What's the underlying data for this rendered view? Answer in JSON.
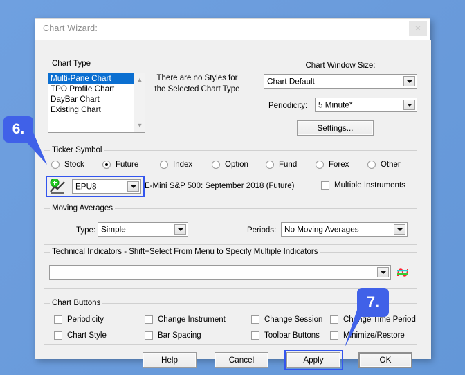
{
  "window": {
    "title": "Chart Wizard:",
    "close_label": "✕"
  },
  "chart_type": {
    "group_label": "Chart Type",
    "items": [
      {
        "label": "Multi-Pane Chart",
        "selected": true
      },
      {
        "label": "TPO Profile Chart",
        "selected": false
      },
      {
        "label": "DayBar Chart",
        "selected": false
      },
      {
        "label": "Existing Chart",
        "selected": false
      }
    ],
    "styles_note_line1": "There are no Styles for",
    "styles_note_line2": "the Selected Chart Type"
  },
  "chart_window": {
    "size_label": "Chart Window Size:",
    "size_value": "Chart Default",
    "periodicity_label": "Periodicity:",
    "periodicity_value": "5 Minute*",
    "settings_button": "Settings..."
  },
  "ticker": {
    "group_label": "Ticker Symbol",
    "radios": [
      {
        "label": "Stock",
        "selected": false
      },
      {
        "label": "Future",
        "selected": true
      },
      {
        "label": "Index",
        "selected": false
      },
      {
        "label": "Option",
        "selected": false
      },
      {
        "label": "Fund",
        "selected": false
      },
      {
        "label": "Forex",
        "selected": false
      },
      {
        "label": "Other",
        "selected": false
      }
    ],
    "symbol_value": "EPU8",
    "description": "E-Mini S&P 500: September 2018 (Future)",
    "multiple_instruments_label": "Multiple Instruments",
    "multiple_instruments_checked": false
  },
  "moving_averages": {
    "group_label": "Moving Averages",
    "type_label": "Type:",
    "type_value": "Simple",
    "periods_label": "Periods:",
    "periods_value": "No Moving Averages"
  },
  "technical_indicators": {
    "group_label": "Technical Indicators  - Shift+Select From Menu to Specify Multiple Indicators",
    "value": ""
  },
  "chart_buttons": {
    "group_label": "Chart Buttons",
    "items": [
      {
        "label": "Periodicity",
        "checked": false
      },
      {
        "label": "Change Instrument",
        "checked": false
      },
      {
        "label": "Change Session",
        "checked": false
      },
      {
        "label": "Change Time Period",
        "checked": false
      },
      {
        "label": "Chart Style",
        "checked": false
      },
      {
        "label": "Bar Spacing",
        "checked": false
      },
      {
        "label": "Toolbar Buttons",
        "checked": false
      },
      {
        "label": "Minimize/Restore",
        "checked": false
      }
    ]
  },
  "footer": {
    "help": "Help",
    "cancel": "Cancel",
    "apply": "Apply",
    "ok": "OK"
  },
  "annotations": {
    "step6": "6.",
    "step7": "7.",
    "accent_color": "#4061e8",
    "highlight_color": "#3355ee"
  }
}
